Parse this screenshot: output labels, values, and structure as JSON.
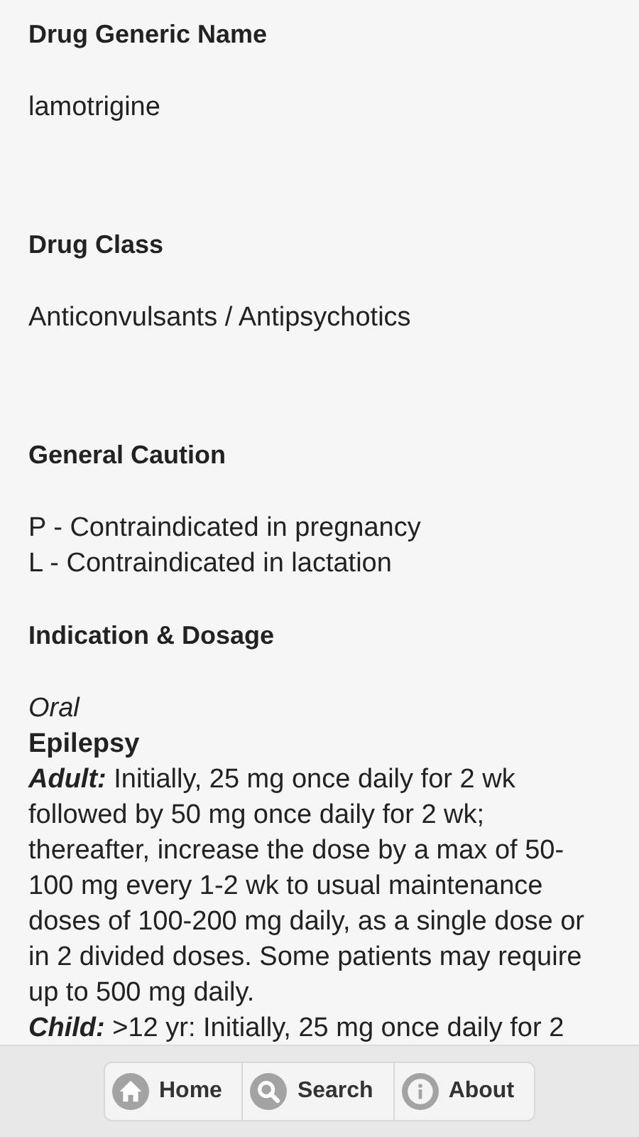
{
  "sections": [
    {
      "heading": "Drug Generic Name",
      "body": [
        {
          "kind": "text",
          "text": "lamotrigine"
        }
      ]
    },
    {
      "heading": "Drug Class",
      "body": [
        {
          "kind": "text",
          "text": "Anticonvulsants / Antipsychotics"
        }
      ]
    },
    {
      "heading": "General Caution",
      "body": [
        {
          "kind": "text",
          "text": "P - Contraindicated in pregnancy"
        },
        {
          "kind": "text",
          "text": "L - Contraindicated in lactation"
        }
      ]
    },
    {
      "heading": "Indication & Dosage",
      "body": [
        {
          "kind": "route",
          "text": "Oral"
        },
        {
          "kind": "indication",
          "text": "Epilepsy"
        },
        {
          "kind": "dose",
          "lead": "Adult:",
          "text": " Initially, 25 mg once daily for 2 wk followed by 50 mg once daily for 2 wk; thereafter, increase the dose by a max of 50-100 mg every 1-2 wk to usual maintenance doses of 100-200 mg daily, as a single dose or in 2 divided doses. Some patients may require up to 500 mg daily."
        },
        {
          "kind": "dose",
          "lead": "Child:",
          "text": " >12 yr: Initially, 25 mg once daily for 2"
        }
      ]
    }
  ],
  "nav": [
    {
      "label": "Home"
    },
    {
      "label": "Search"
    },
    {
      "label": "About"
    }
  ]
}
